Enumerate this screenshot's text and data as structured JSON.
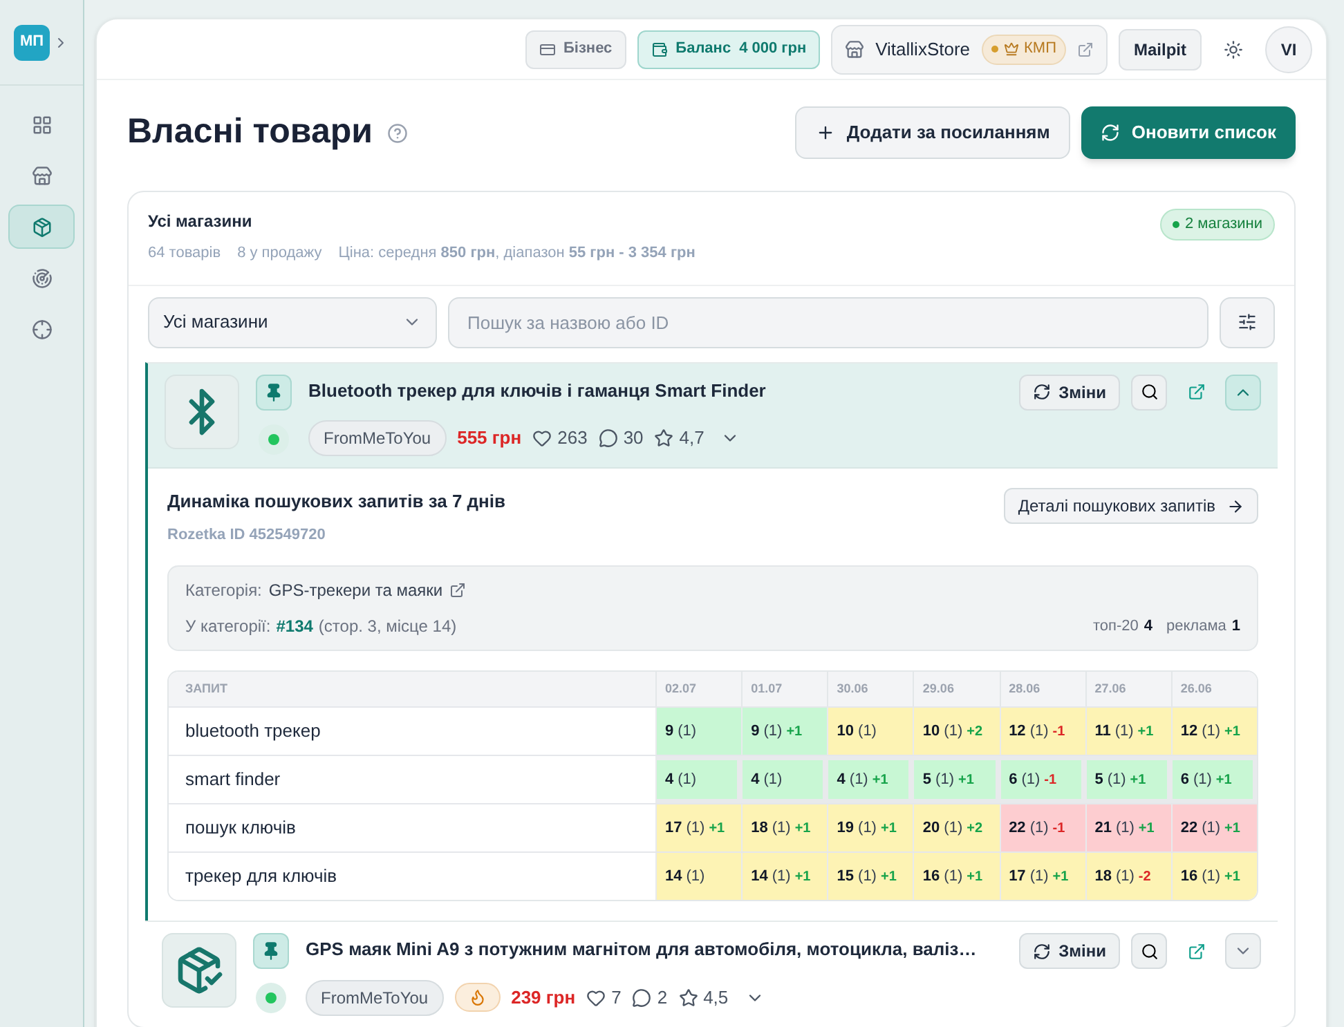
{
  "logo": {
    "text": "МП"
  },
  "sidebar": {
    "items": [
      {
        "kind": "grid",
        "selected": false
      },
      {
        "kind": "store",
        "selected": false
      },
      {
        "kind": "package",
        "selected": true
      },
      {
        "kind": "radar",
        "selected": false
      },
      {
        "kind": "crosshair",
        "selected": false
      }
    ]
  },
  "topbar": {
    "business": "Бізнес",
    "balance_label": "Баланс",
    "balance_value": "4 000 грн",
    "store": "VitallixStore",
    "store_badge": "КМП",
    "mail": "Mailpit",
    "avatar": "VI"
  },
  "page": {
    "title": "Власні товари",
    "add_button": "Додати за посиланням",
    "refresh_button": "Оновити список"
  },
  "summary": {
    "title": "Усі магазини",
    "badge": "2 магазини",
    "stats": [
      "64 товарів",
      "8 у продажу"
    ],
    "price_text": "Ціна: середня **850 грн**, діапазон **55 грн - 3 354 грн**"
  },
  "filters": {
    "store_select": "Усі магазини",
    "search_placeholder": "Пошук за назвою або ID"
  },
  "products": [
    {
      "kind": "bluetooth",
      "title": "Bluetooth трекер для ключів і гаманця Smart Finder",
      "store": "FromMeToYou",
      "hot": false,
      "price": "555 грн",
      "likes": "263",
      "comments": "30",
      "rating": "4,7",
      "changes_button": "Зміни",
      "expanded": true,
      "active": true,
      "details": {
        "title": "Динаміка пошукових запитів за 7 днів",
        "subtitle": "Rozetka ID 452549720",
        "details_button": "Деталі пошукових запитів",
        "category_label": "Категорія:",
        "category": "GPS-трекери та маяки",
        "position_label": "У категорії:",
        "position": "#134",
        "position_note": "(стор. 3, місце 14)",
        "top_label": "топ-20",
        "top_value": "4",
        "ads_label": "реклама",
        "ads_value": "1",
        "table": {
          "columns": [
            "ЗАПИТ",
            "02.07",
            "01.07",
            "30.06",
            "29.06",
            "28.06",
            "27.06",
            "26.06"
          ],
          "rows": [
            {
              "outlined": false,
              "cells": [
                {
                  "text": "bluetooth трекер"
                },
                {
                  "value": "9",
                  "note": "(1)",
                  "color": "#c8f7d4"
                },
                {
                  "value": "9",
                  "note": "(1)",
                  "delta": "+1",
                  "negative": false,
                  "color": "#c8f7d4"
                },
                {
                  "value": "10",
                  "note": "(1)",
                  "color": "#fdf3b4"
                },
                {
                  "value": "10",
                  "note": "(1)",
                  "delta": "+2",
                  "negative": false,
                  "color": "#fdf3b4"
                },
                {
                  "value": "12",
                  "note": "(1)",
                  "delta": "-1",
                  "negative": true,
                  "color": "#fdf3b4"
                },
                {
                  "value": "11",
                  "note": "(1)",
                  "delta": "+1",
                  "negative": false,
                  "color": "#fdf3b4"
                },
                {
                  "value": "12",
                  "note": "(1)",
                  "delta": "+1",
                  "negative": false,
                  "color": "#fdf3b4"
                }
              ]
            },
            {
              "outlined": true,
              "cells": [
                {
                  "text": "smart finder"
                },
                {
                  "value": "4",
                  "note": "(1)",
                  "color": "#c8f7d4"
                },
                {
                  "value": "4",
                  "note": "(1)",
                  "color": "#c8f7d4"
                },
                {
                  "value": "4",
                  "note": "(1)",
                  "delta": "+1",
                  "negative": false,
                  "color": "#c8f7d4"
                },
                {
                  "value": "5",
                  "note": "(1)",
                  "delta": "+1",
                  "negative": false,
                  "color": "#c8f7d4"
                },
                {
                  "value": "6",
                  "note": "(1)",
                  "delta": "-1",
                  "negative": true,
                  "color": "#c8f7d4"
                },
                {
                  "value": "5",
                  "note": "(1)",
                  "delta": "+1",
                  "negative": false,
                  "color": "#c8f7d4"
                },
                {
                  "value": "6",
                  "note": "(1)",
                  "delta": "+1",
                  "negative": false,
                  "color": "#c8f7d4"
                }
              ]
            },
            {
              "outlined": false,
              "cells": [
                {
                  "text": "пошук ключів"
                },
                {
                  "value": "17",
                  "note": "(1)",
                  "delta": "+1",
                  "negative": false,
                  "color": "#fdf3b4"
                },
                {
                  "value": "18",
                  "note": "(1)",
                  "delta": "+1",
                  "negative": false,
                  "color": "#fdf3b4"
                },
                {
                  "value": "19",
                  "note": "(1)",
                  "delta": "+1",
                  "negative": false,
                  "color": "#fdf3b4"
                },
                {
                  "value": "20",
                  "note": "(1)",
                  "delta": "+2",
                  "negative": false,
                  "color": "#fdf3b4"
                },
                {
                  "value": "22",
                  "note": "(1)",
                  "delta": "-1",
                  "negative": true,
                  "color": "#fdcdd0"
                },
                {
                  "value": "21",
                  "note": "(1)",
                  "delta": "+1",
                  "negative": false,
                  "color": "#fdcdd0"
                },
                {
                  "value": "22",
                  "note": "(1)",
                  "delta": "+1",
                  "negative": false,
                  "color": "#fdcdd0"
                }
              ]
            },
            {
              "outlined": false,
              "cells": [
                {
                  "text": "трекер для ключів"
                },
                {
                  "value": "14",
                  "note": "(1)",
                  "color": "#fdf3b4"
                },
                {
                  "value": "14",
                  "note": "(1)",
                  "delta": "+1",
                  "negative": false,
                  "color": "#fdf3b4"
                },
                {
                  "value": "15",
                  "note": "(1)",
                  "delta": "+1",
                  "negative": false,
                  "color": "#fdf3b4"
                },
                {
                  "value": "16",
                  "note": "(1)",
                  "delta": "+1",
                  "negative": false,
                  "color": "#fdf3b4"
                },
                {
                  "value": "17",
                  "note": "(1)",
                  "delta": "+1",
                  "negative": false,
                  "color": "#fdf3b4"
                },
                {
                  "value": "18",
                  "note": "(1)",
                  "delta": "-2",
                  "negative": true,
                  "color": "#fdf3b4"
                },
                {
                  "value": "16",
                  "note": "(1)",
                  "delta": "+1",
                  "negative": false,
                  "color": "#fdf3b4"
                }
              ]
            }
          ]
        }
      }
    },
    {
      "kind": "package",
      "title": "GPS маяк Mini A9 з потужним магнітом для автомобіля, мотоцикла, валіз…",
      "store": "FromMeToYou",
      "hot": true,
      "price": "239 грн",
      "likes": "7",
      "comments": "2",
      "rating": "4,5",
      "changes_button": "Зміни",
      "expanded": false,
      "active": true
    }
  ]
}
